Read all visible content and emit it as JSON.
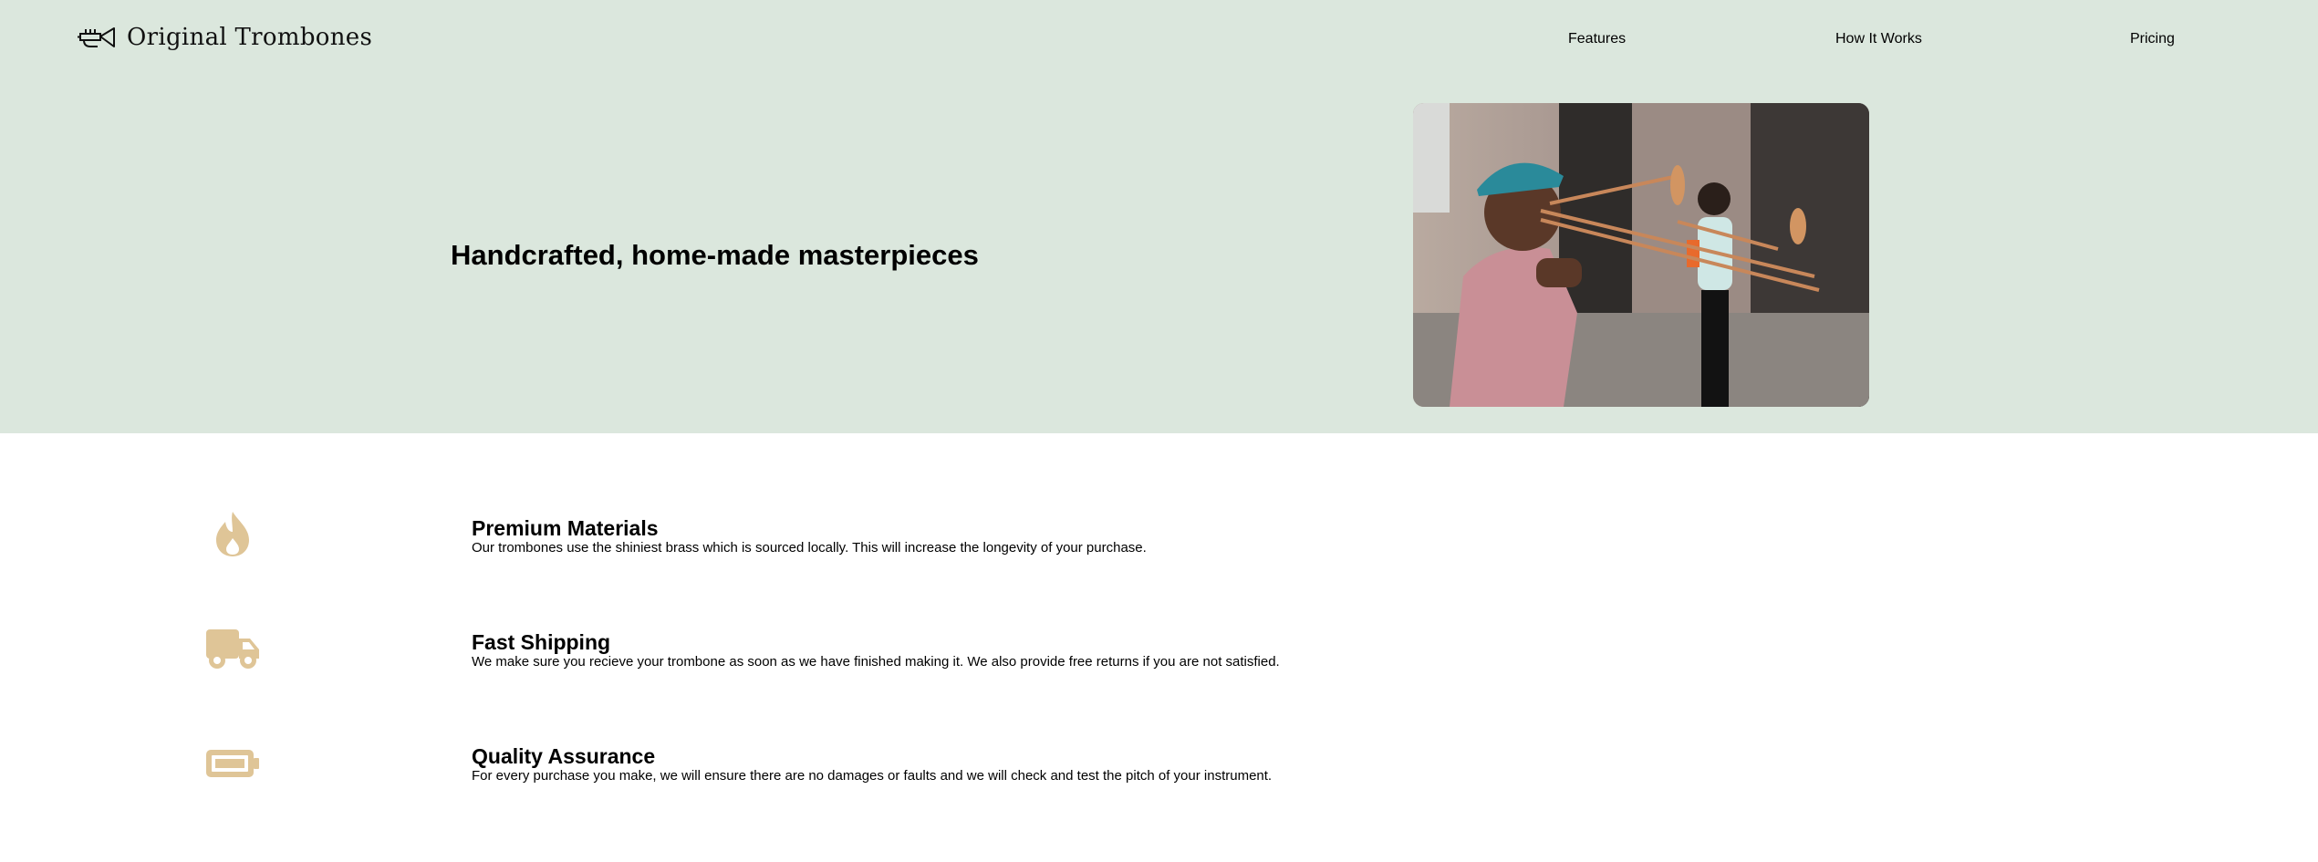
{
  "brand": {
    "name": "Original Trombones",
    "logo_icon": "trumpet-icon"
  },
  "nav": {
    "items": [
      "Features",
      "How It Works",
      "Pricing"
    ]
  },
  "hero": {
    "title": "Handcrafted, home-made masterpieces",
    "image": "two-trombone-players-photo"
  },
  "features": [
    {
      "icon": "flame-icon",
      "title": "Premium Materials",
      "description": "Our trombones use the shiniest brass which is sourced locally. This will increase the longevity of your purchase."
    },
    {
      "icon": "truck-icon",
      "title": "Fast Shipping",
      "description": "We make sure you recieve your trombone as soon as we have finished making it. We also provide free returns if you are not satisfied."
    },
    {
      "icon": "battery-full-icon",
      "title": "Quality Assurance",
      "description": "For every purchase you make, we will ensure there are no damages or faults and we will check and test the pitch of your instrument."
    }
  ],
  "colors": {
    "header_background": "#dbe7dd",
    "icon_accent": "#dfc597",
    "text": "#000000"
  }
}
